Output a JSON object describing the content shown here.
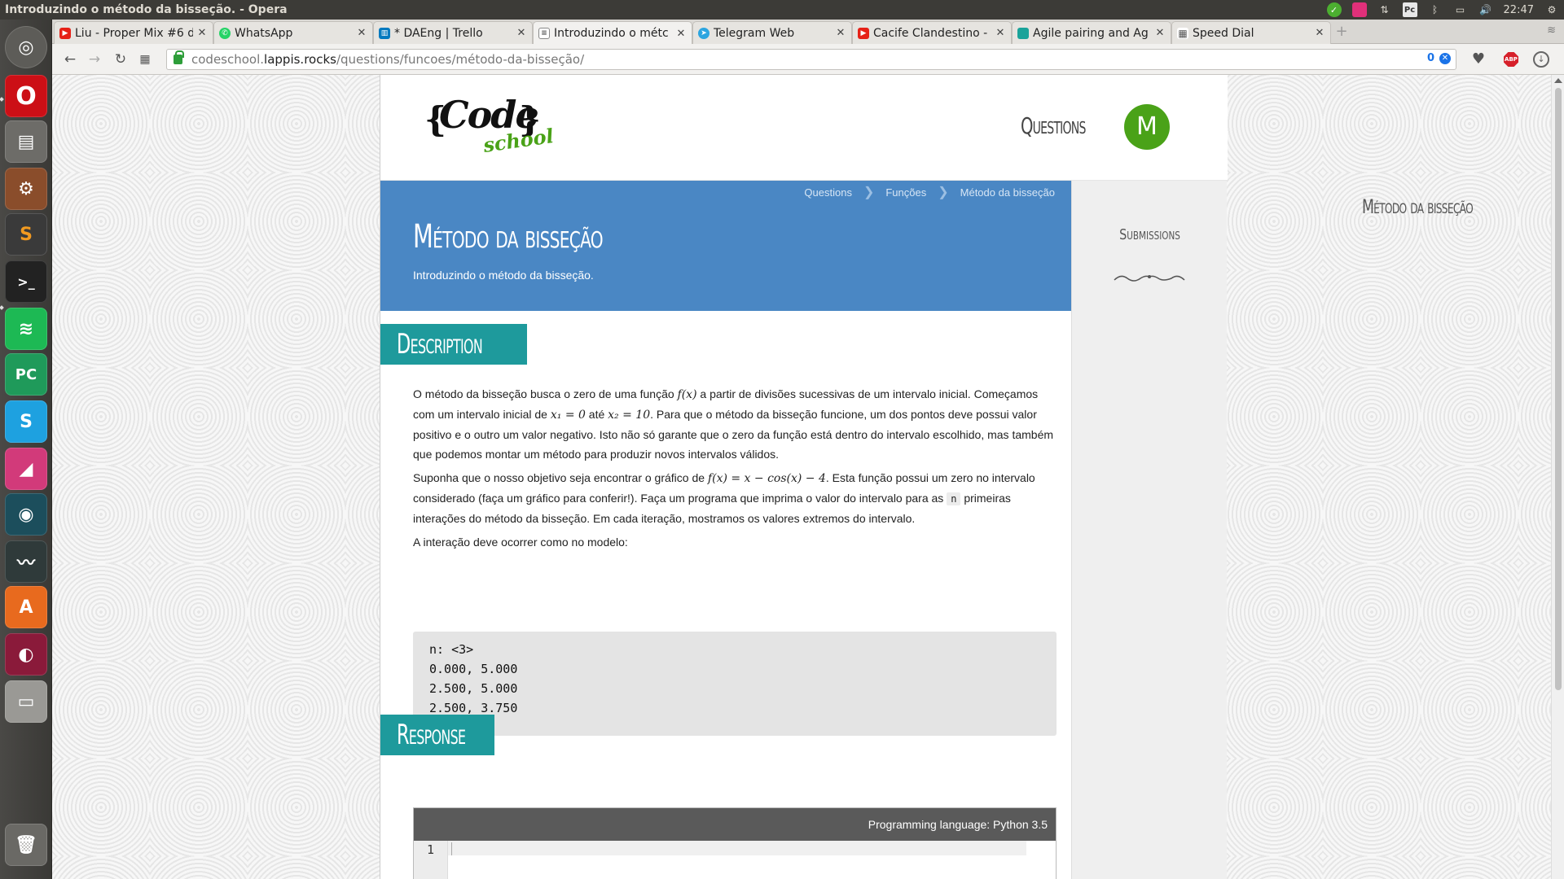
{
  "window": {
    "title": "Introduzindo o método da bisseção. - Opera"
  },
  "tray": {
    "clock": "22:47",
    "pc_label": "Pc"
  },
  "tabs": [
    {
      "label": "Liu - Proper Mix #6 d",
      "fav": "yt",
      "active": false
    },
    {
      "label": "WhatsApp",
      "fav": "wa",
      "active": false
    },
    {
      "label": "* DAEng | Trello",
      "fav": "tr",
      "active": false
    },
    {
      "label": "Introduzindo o métc",
      "fav": "doc",
      "active": true
    },
    {
      "label": "Telegram Web",
      "fav": "tg",
      "active": false
    },
    {
      "label": "Cacife Clandestino -",
      "fav": "yt",
      "active": false
    },
    {
      "label": "Agile pairing and Ag",
      "fav": "ag",
      "active": false
    },
    {
      "label": "Speed Dial",
      "fav": "sd",
      "active": false
    }
  ],
  "address": {
    "prefix": "codeschool.",
    "host": "lappis.rocks",
    "path": "/questions/funcoes/método-da-bisseção/",
    "badge_count": "0"
  },
  "extensions": {
    "abp_label": "ABP"
  },
  "colors": {
    "banner": "#4a87c4",
    "section": "#1e9a9c",
    "brand_green": "#4aa218"
  },
  "site": {
    "logo": {
      "open": "{",
      "code": "Code",
      "close": "}",
      "school": "school"
    },
    "nav_questions": "Questions",
    "avatar_letter": "M",
    "breadcrumb": [
      "Questions",
      "Funções",
      "Método da bisseção"
    ],
    "breadcrumb_sep": "❯",
    "title": "Método da bisseção",
    "subtitle": "Introduzindo o método da bisseção.",
    "sidebar": {
      "title": "Método da bisseção",
      "submissions": "Submissions"
    }
  },
  "description": {
    "heading": "Description",
    "p1a": "O método da bisseção busca o zero de uma função ",
    "p1_fx": "f(x)",
    "p1b": " a partir de divisões sucessivas de um intervalo inicial. Começamos com um intervalo inicial de ",
    "p1_x1": "x₁ = 0",
    "p1c": " até ",
    "p1_x2": "x₂ = 10",
    "p1d": ". Para que o método da bisseção funcione, um dos pontos deve possui valor positivo e o outro um valor negativo. Isto não só garante que o zero da função está dentro do intervalo escolhido, mas também que podemos montar um método para produzir novos intervalos válidos.",
    "p2a": "Suponha que o nosso objetivo seja encontrar o gráfico de ",
    "p2_f": "f(x) = x − cos(x) − 4",
    "p2b": ". Esta função possui um zero no intervalo considerado (faça um gráfico para conferir!). Faça um programa que imprima o valor do intervalo para as ",
    "p2_n": "n",
    "p2c": " primeiras interações do método da bisseção. Em cada iteração, mostramos os valores extremos do intervalo.",
    "p3": "A interação deve ocorrer como no modelo:",
    "example": [
      "n: <3>",
      "0.000, 5.000",
      "2.500, 5.000",
      "2.500, 3.750"
    ]
  },
  "response": {
    "heading": "Response",
    "language": "Programming language: Python 3.5",
    "line_number": "1"
  }
}
